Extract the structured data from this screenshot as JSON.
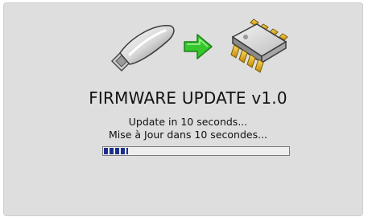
{
  "screen": {
    "title": "FIRMWARE UPDATE v1.0",
    "message_en": "Update in 10 seconds...",
    "message_fr": "Mise à Jour dans 10 secondes..."
  },
  "icons": {
    "source": "usb-drive-icon",
    "direction": "arrow-right-icon",
    "target": "microchip-icon"
  },
  "progress": {
    "fraction": 0.13,
    "fill_color": "#1c2f8c"
  },
  "colors": {
    "background": "#dedede",
    "arrow": "#36c72c"
  }
}
